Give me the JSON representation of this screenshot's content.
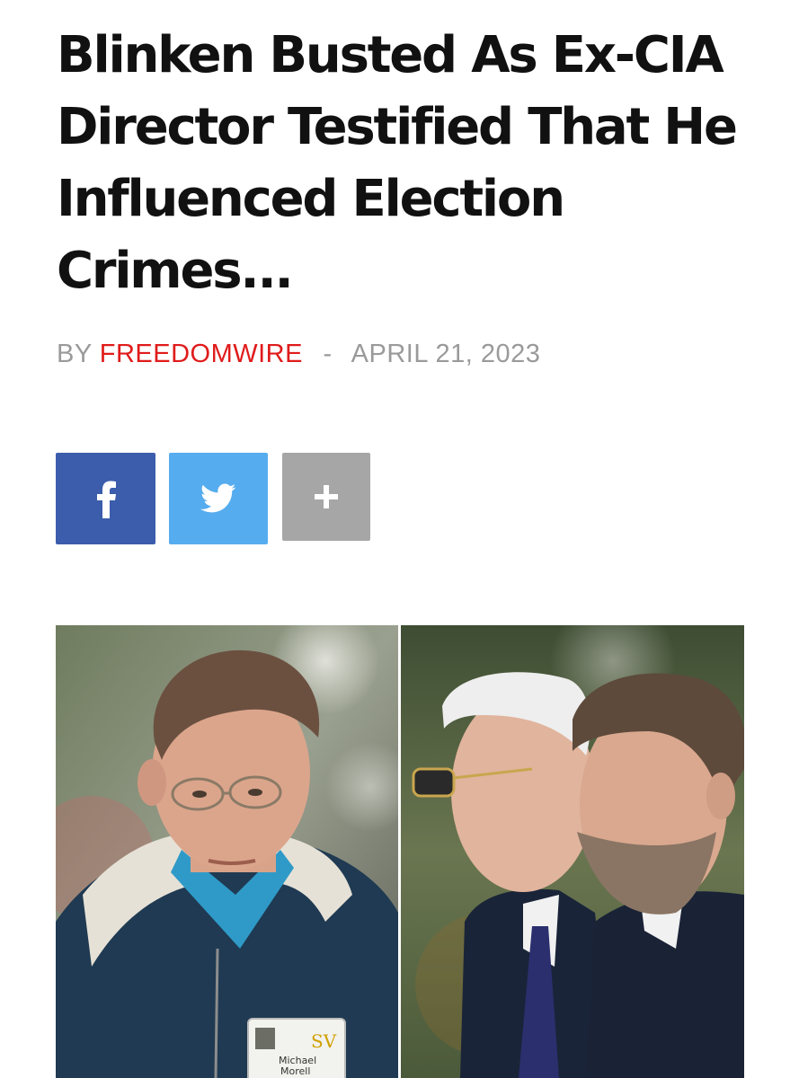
{
  "article": {
    "title": "Blinken Busted As Ex-CIA Director Testified That He Influenced Election Crimes...",
    "byline": {
      "prefix": "BY",
      "author": "FREEDOMWIRE",
      "separator": "-",
      "date": "APRIL 21, 2023"
    }
  },
  "share_buttons": [
    {
      "network": "facebook",
      "icon": "facebook-icon",
      "color": "#3b5dab"
    },
    {
      "network": "twitter",
      "icon": "twitter-icon",
      "color": "#55acee"
    },
    {
      "network": "more",
      "icon": "plus-icon",
      "color": "#a6a6a6"
    }
  ],
  "photo": {
    "badge": {
      "logo": "SV",
      "name_line1": "Michael",
      "name_line2": "Morell"
    }
  },
  "colors": {
    "author_accent": "#e01b1b",
    "meta_gray": "#9a9a9a",
    "title_text": "#111111"
  }
}
